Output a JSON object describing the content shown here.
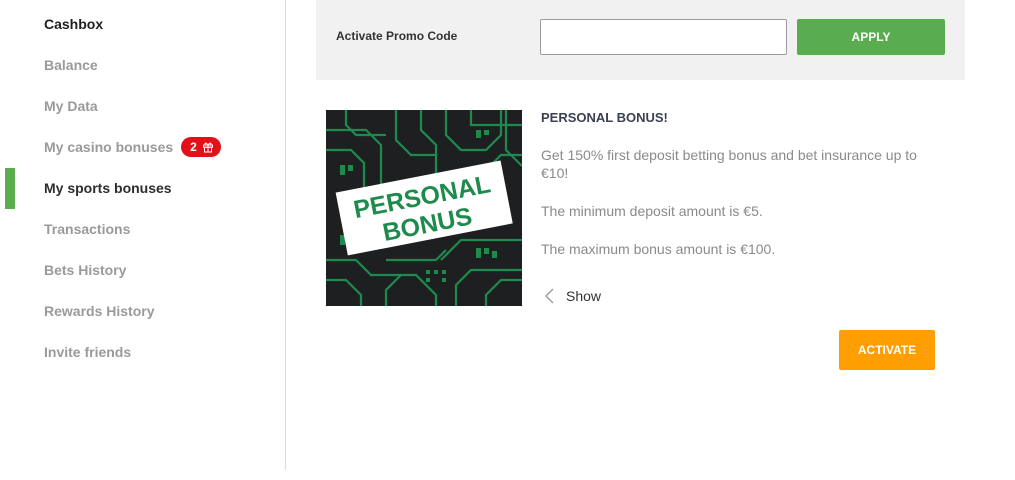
{
  "sidebar": {
    "items": [
      {
        "label": "Cashbox"
      },
      {
        "label": "Balance"
      },
      {
        "label": "My Data"
      },
      {
        "label": "My casino bonuses",
        "badge": "2",
        "badge_icon": "gift-icon"
      },
      {
        "label": "My sports bonuses",
        "active": true
      },
      {
        "label": "Transactions"
      },
      {
        "label": "Bets History"
      },
      {
        "label": "Rewards History"
      },
      {
        "label": "Invite friends"
      }
    ]
  },
  "promo": {
    "label": "Activate Promo Code",
    "input_value": "",
    "apply_label": "APPLY"
  },
  "bonus": {
    "image_text_line1": "PERSONAL",
    "image_text_line2": "BONUS",
    "title": "PERSONAL BONUS!",
    "description": [
      "Get 150% first deposit betting bonus and bet insurance up to €10!",
      "The minimum deposit amount is €5.",
      "The maximum bonus amount is €100."
    ],
    "show_label": "Show",
    "show_icon": "chevron-left-icon",
    "activate_label": "ACTIVATE"
  },
  "colors": {
    "accent_green": "#5aad4e",
    "activate_orange": "#ff9e00",
    "badge_red": "#e3101a",
    "image_bg": "#1d1f21",
    "image_circuit": "#1e8a4c"
  }
}
